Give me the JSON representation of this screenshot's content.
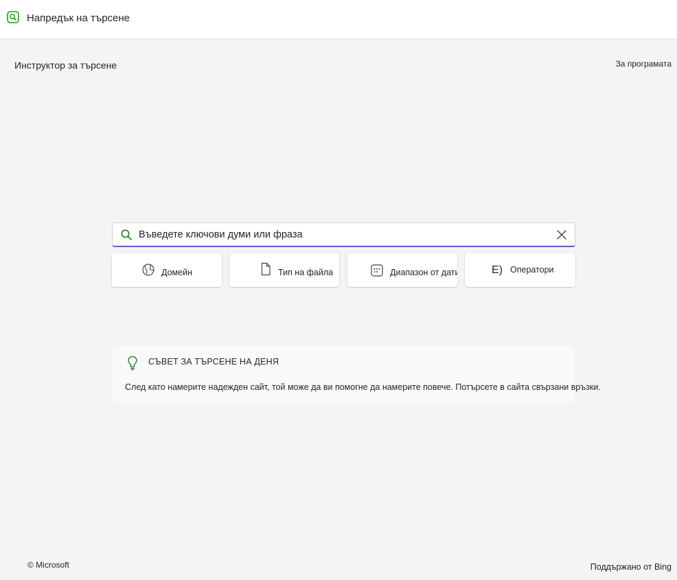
{
  "header": {
    "title": "Напредък на търсене",
    "icon": "search-app-icon",
    "accent_color": "#13a10e"
  },
  "subheader": {
    "title": "Инструктор за търсене",
    "about_link": "За програмата"
  },
  "search": {
    "placeholder": "Въведете ключови думи или фраза",
    "value": "",
    "icon": "search-icon",
    "clear_icon": "close-icon",
    "focus_color": "#5b5fc7"
  },
  "filters": [
    {
      "label": "Домейн",
      "icon": "globe-icon"
    },
    {
      "label": "Тип на файла",
      "icon": "document-icon"
    },
    {
      "label": "Диапазон от дати",
      "icon": "calendar-icon"
    },
    {
      "label": "Оператори",
      "icon_text": "E)"
    }
  ],
  "tip": {
    "icon": "lightbulb-icon",
    "icon_color": "#107c10",
    "title": "СЪВЕТ ЗА ТЪРСЕНЕ НА ДЕНЯ",
    "body": "След като намерите надежден сайт, той може да ви помогне да намерите повече. Потърсете в сайта свързани връзки."
  },
  "footer": {
    "copyright": "© Microsoft",
    "powered_by": "Поддържано от Bing"
  }
}
